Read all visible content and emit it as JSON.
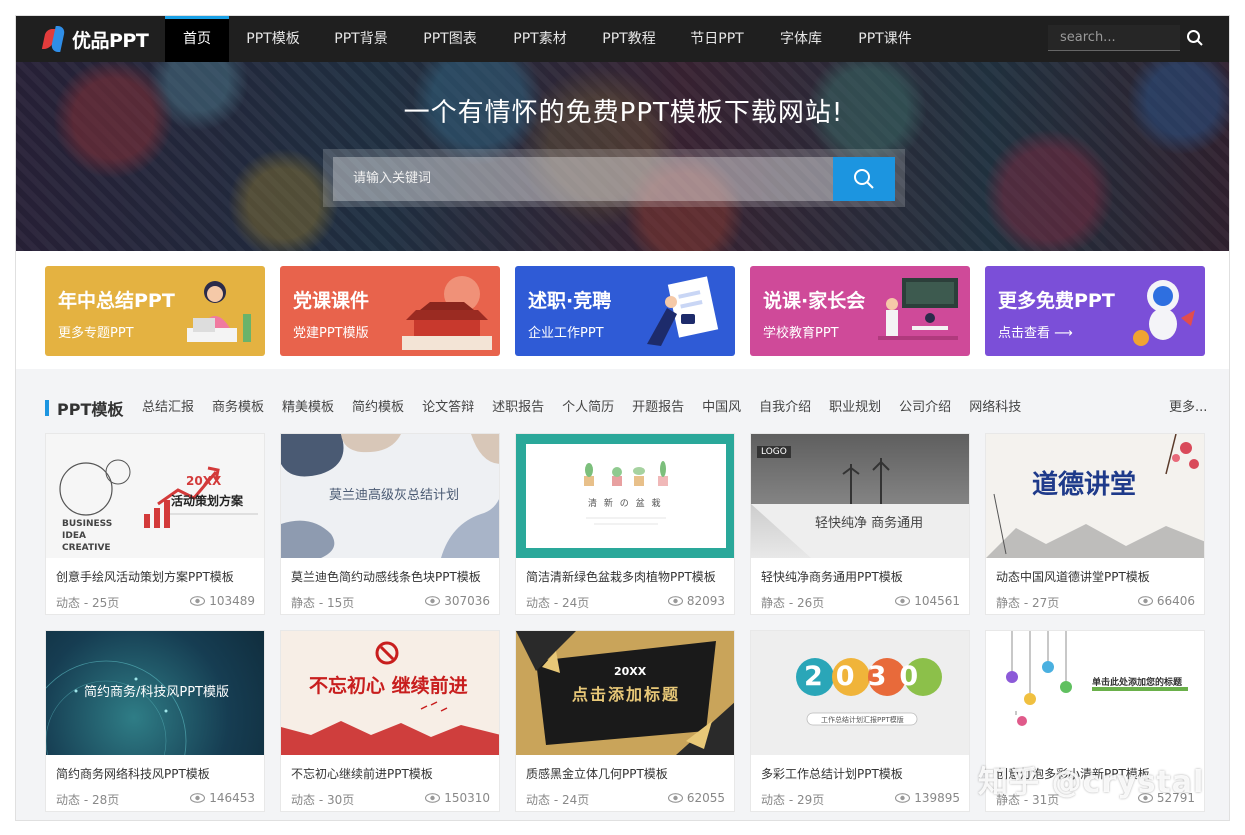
{
  "nav": {
    "logo_text": "优品PPT",
    "items": [
      {
        "label": "首页",
        "active": true
      },
      {
        "label": "PPT模板"
      },
      {
        "label": "PPT背景"
      },
      {
        "label": "PPT图表"
      },
      {
        "label": "PPT素材"
      },
      {
        "label": "PPT教程"
      },
      {
        "label": "节日PPT"
      },
      {
        "label": "字体库"
      },
      {
        "label": "PPT课件"
      }
    ],
    "search_placeholder": "search...",
    "search_icon": "search-icon"
  },
  "hero": {
    "title": "一个有情怀的免费PPT模板下载网站!",
    "search_placeholder": "请输入关键词",
    "search_icon": "search-icon"
  },
  "banners": [
    {
      "title": "年中总结PPT",
      "subtitle": "更多专题PPT",
      "color": "#e0ad3a"
    },
    {
      "title": "党课课件",
      "subtitle": "党建PPT模版",
      "color": "#e8604a"
    },
    {
      "title": "述职·竞聘",
      "subtitle": "企业工作PPT",
      "color": "#2f5bd6"
    },
    {
      "title": "说课·家长会",
      "subtitle": "学校教育PPT",
      "color": "#d0479a"
    },
    {
      "title": "更多免费PPT",
      "subtitle": "点击查看 ⟶",
      "color": "#7b4fd8"
    }
  ],
  "section": {
    "title": "PPT模板",
    "categories": [
      "总结汇报",
      "商务模板",
      "精美模板",
      "简约模板",
      "论文答辩",
      "述职报告",
      "个人简历",
      "开题报告",
      "中国风",
      "自我介绍",
      "职业规划",
      "公司介绍",
      "网络科技"
    ],
    "more": "更多..."
  },
  "cards": [
    {
      "title": "创意手绘风活动策划方案PPT模板",
      "meta": "动态 - 25页",
      "views": "103489",
      "thumb_text": "活动策划方案",
      "thumb_sub": "20XX",
      "thumb_extra": "BUSINESS IDEA CREATIVE"
    },
    {
      "title": "莫兰迪色简约动感线条色块PPT模板",
      "meta": "静态 - 15页",
      "views": "307036",
      "thumb_text": "莫兰迪高级灰总结计划"
    },
    {
      "title": "简洁清新绿色盆栽多肉植物PPT模板",
      "meta": "动态 - 24页",
      "views": "82093",
      "thumb_text": "清 新 の 盆 栽"
    },
    {
      "title": "轻快纯净商务通用PPT模板",
      "meta": "静态 - 26页",
      "views": "104561",
      "thumb_text": "轻快纯净 商务通用",
      "thumb_sub": "LOGO"
    },
    {
      "title": "动态中国风道德讲堂PPT模板",
      "meta": "静态 - 27页",
      "views": "66406",
      "thumb_text": "道德讲堂"
    },
    {
      "title": "简约商务网络科技风PPT模板",
      "meta": "动态 - 28页",
      "views": "146453",
      "thumb_text": "简约商务/科技风PPT模版"
    },
    {
      "title": "不忘初心继续前进PPT模板",
      "meta": "动态 - 30页",
      "views": "150310",
      "thumb_text": "不忘初心 继续前进"
    },
    {
      "title": "质感黑金立体几何PPT模板",
      "meta": "动态 - 24页",
      "views": "62055",
      "thumb_text": "点击添加标题",
      "thumb_sub": "20XX"
    },
    {
      "title": "多彩工作总结计划PPT模板",
      "meta": "动态 - 29页",
      "views": "139895",
      "thumb_text": "2030",
      "thumb_sub": "工作总结计划汇报PPT模版"
    },
    {
      "title": "创意灯泡多彩小清新PPT模板",
      "meta": "静态 - 31页",
      "views": "52791",
      "thumb_text": "单击此处添加您的标题"
    }
  ],
  "watermark": "知乎 @crystal"
}
